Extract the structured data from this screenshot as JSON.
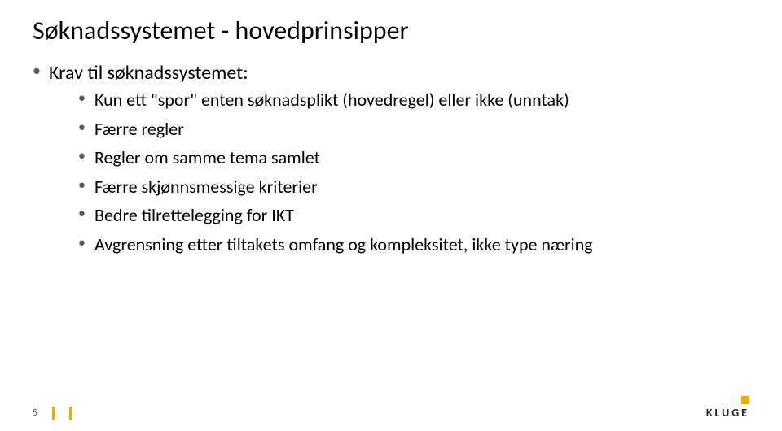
{
  "title": "Søknadssystemet - hovedprinsipper",
  "bullets": {
    "l1": "Krav til søknadssystemet:",
    "children": {
      "c1": "Kun ett \"spor\" enten søknadsplikt (hovedregel) eller ikke (unntak)",
      "c2": "Færre regler",
      "c3": "Regler om samme tema samlet",
      "c4": "Færre skjønnsmessige kriterier",
      "c5": "Bedre tilrettelegging for IKT",
      "c6": "Avgrensning etter tiltakets omfang og kompleksitet, ikke type næring"
    }
  },
  "page_number": "5",
  "logo": "KLUGE"
}
